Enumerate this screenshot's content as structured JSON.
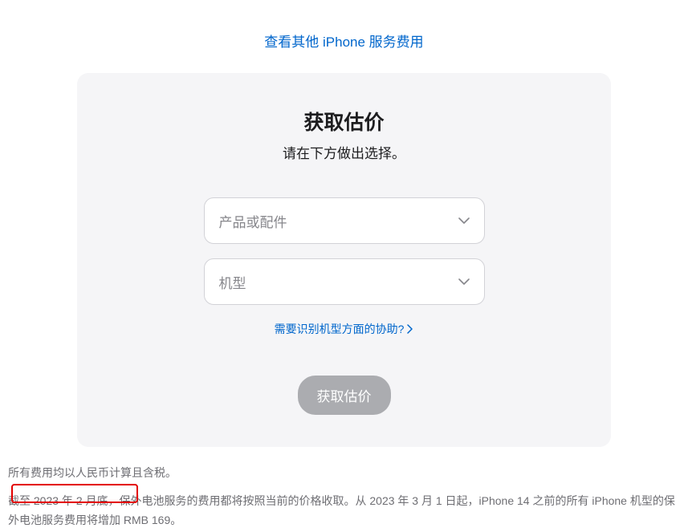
{
  "topLink": "查看其他 iPhone 服务费用",
  "card": {
    "title": "获取估价",
    "subtitle": "请在下方做出选择。",
    "select1": "产品或配件",
    "select2": "机型",
    "helpLink": "需要识别机型方面的协助?",
    "submitButton": "获取估价"
  },
  "footnote1": "所有费用均以人民币计算且含税。",
  "footnote2": "截至 2023 年 2 月底，保外电池服务的费用都将按照当前的价格收取。从 2023 年 3 月 1 日起，iPhone 14 之前的所有 iPhone 机型的保外电池服务费用将增加 RMB 169。"
}
